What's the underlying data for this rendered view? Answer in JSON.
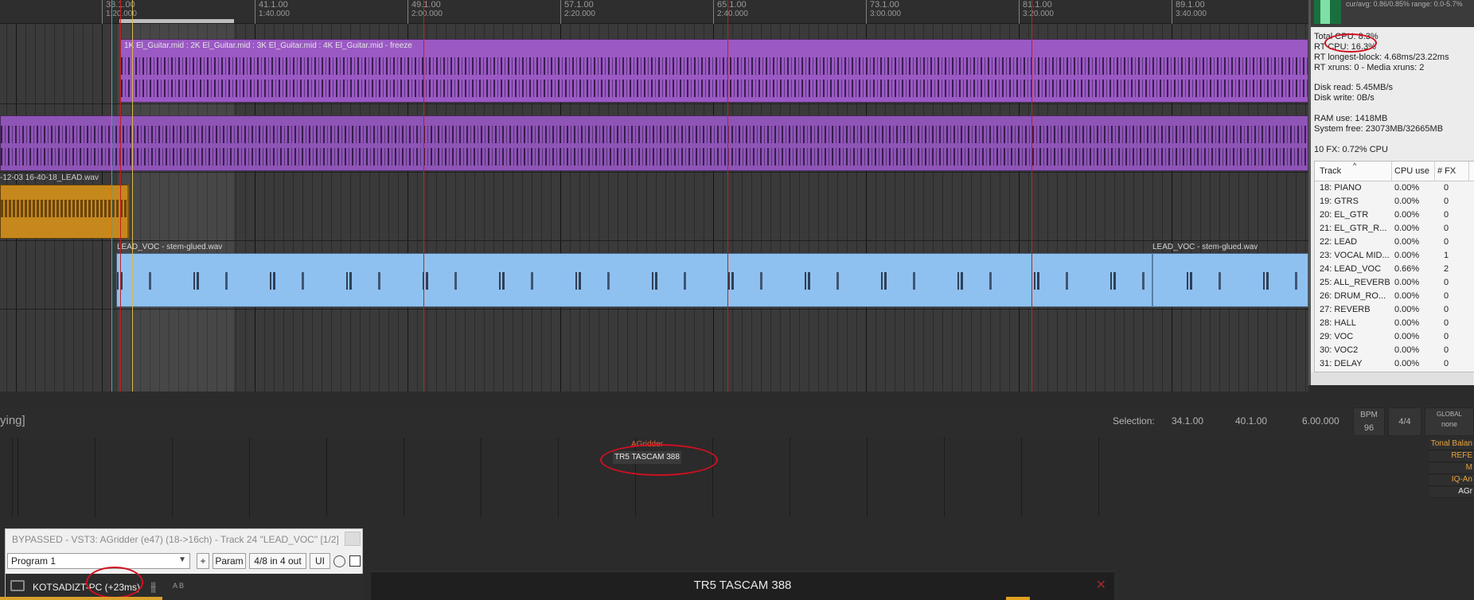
{
  "ruler": {
    "marks": [
      {
        "bar": "33.1.00",
        "time": "1:20.000"
      },
      {
        "bar": "41.1.00",
        "time": "1:40.000"
      },
      {
        "bar": "49.1.00",
        "time": "2:00.000"
      },
      {
        "bar": "57.1.00",
        "time": "2:20.000"
      },
      {
        "bar": "65.1.00",
        "time": "2:40.000"
      },
      {
        "bar": "73.1.00",
        "time": "3:00.000"
      },
      {
        "bar": "81.1.00",
        "time": "3:20.000"
      },
      {
        "bar": "89.1.00",
        "time": "3:40.000"
      }
    ]
  },
  "items": {
    "gtr_label": "1K El_Guitar.mid : 2K El_Guitar.mid : 3K El_Guitar.mid : 4K El_Guitar.mid - freeze",
    "lead_label": "-12-03 16-40-18_LEAD.wav",
    "voc_label_1": "LEAD_VOC - stem-glued.wav",
    "voc_label_2": "LEAD_VOC - stem-glued.wav"
  },
  "perf": {
    "cur_avg": "cur/avg: 0.86/0.85%  range: 0.0-5.7%",
    "total_cpu": "Total CPU: 8.3%",
    "rt_cpu": "RT CPU: 16.3%",
    "rt_longest": "RT longest-block: 4.68ms/23.22ms",
    "rt_xruns": "RT xruns: 0 - Media xruns: 2",
    "disk_read": "Disk read: 5.45MB/s",
    "disk_write": "Disk write: 0B/s",
    "ram_use": "RAM use: 1418MB",
    "system_free": "System free: 23073MB/32665MB",
    "fx_cpu": "10 FX: 0.72% CPU",
    "headers": {
      "track": "Track",
      "cpu": "CPU use",
      "fx": "# FX"
    },
    "rows": [
      {
        "track": "18: PIANO",
        "cpu": "0.00%",
        "fx": "0"
      },
      {
        "track": "19: GTRS",
        "cpu": "0.00%",
        "fx": "0"
      },
      {
        "track": "20: EL_GTR",
        "cpu": "0.00%",
        "fx": "0"
      },
      {
        "track": "21: EL_GTR_R...",
        "cpu": "0.00%",
        "fx": "0"
      },
      {
        "track": "22: LEAD",
        "cpu": "0.00%",
        "fx": "0"
      },
      {
        "track": "23: VOCAL MID...",
        "cpu": "0.00%",
        "fx": "1"
      },
      {
        "track": "24: LEAD_VOC",
        "cpu": "0.66%",
        "fx": "2"
      },
      {
        "track": "25: ALL_REVERB",
        "cpu": "0.00%",
        "fx": "0"
      },
      {
        "track": "26: DRUM_RO...",
        "cpu": "0.00%",
        "fx": "0"
      },
      {
        "track": "27: REVERB",
        "cpu": "0.00%",
        "fx": "0"
      },
      {
        "track": "28: HALL",
        "cpu": "0.00%",
        "fx": "0"
      },
      {
        "track": "29: VOC",
        "cpu": "0.00%",
        "fx": "0"
      },
      {
        "track": "30: VOC2",
        "cpu": "0.00%",
        "fx": "0"
      },
      {
        "track": "31: DELAY",
        "cpu": "0.00%",
        "fx": "0"
      }
    ]
  },
  "transport": {
    "status_partial": "ying]",
    "selection_label": "Selection:",
    "sel_start": "34.1.00",
    "sel_end": "40.1.00",
    "sel_length": "6.00.000",
    "bpm_label": "BPM",
    "bpm_value": "96",
    "time_sig": "4/4",
    "global_label": "GLOBAL",
    "global_value": "none"
  },
  "mixer": {
    "fx_slot_1": "AGridder",
    "fx_slot_2": "TR5 TASCAM 388",
    "right_fx": [
      "Tonal Balan",
      "REFE",
      "M",
      "IQ-An",
      "AGr"
    ]
  },
  "fx_window": {
    "title": "BYPASSED - VST3: AGridder (e47) (18->16ch) - Track 24 \"LEAD_VOC\" [1/2]",
    "program": "Program 1",
    "plus": "+",
    "param": "Param",
    "io": "4/8 in 4 out",
    "ui": "UI",
    "pdc_label": "KOTSADIZT-PC (+23ms)",
    "ab": "A  B"
  },
  "tr5_window": {
    "title": "TR5 TASCAM 388",
    "close": "✕"
  },
  "colors": {
    "guitar_item": "#9b59c4",
    "lead_item": "#c6881c",
    "vocal_item": "#8fc1f0",
    "annotation_red": "#d01020",
    "marker_red": "#c02020"
  }
}
